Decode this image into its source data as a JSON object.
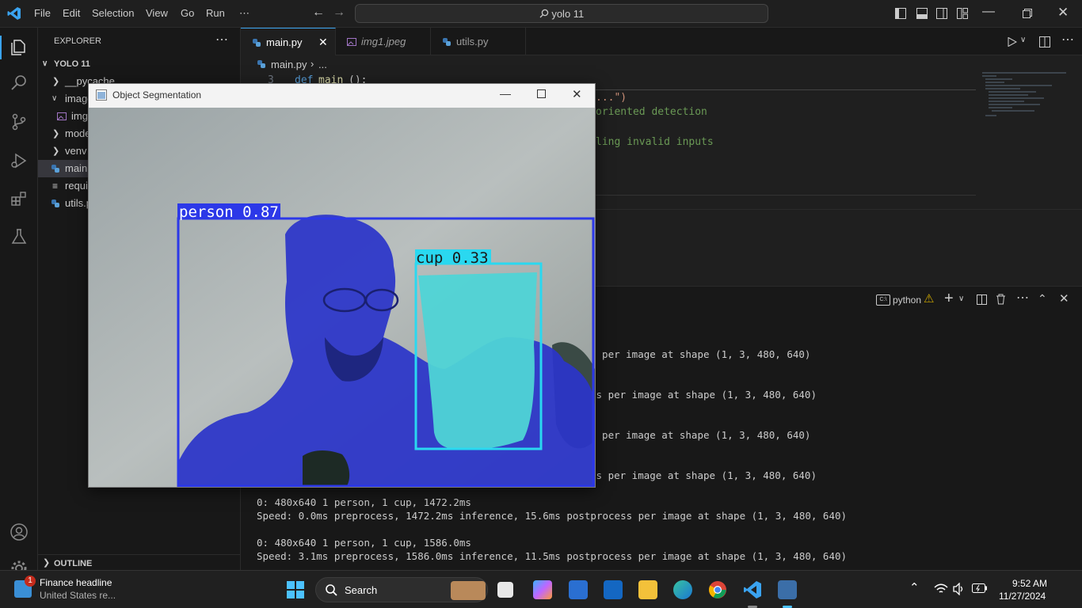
{
  "menu": [
    "File",
    "Edit",
    "Selection",
    "View",
    "Go",
    "Run",
    "⋯"
  ],
  "command_center": "yolo 11",
  "explorer": {
    "title": "EXPLORER",
    "root": "YOLO 11",
    "items": [
      {
        "label": "__pycache__",
        "kind": "folder"
      },
      {
        "label": "images",
        "kind": "folder-open"
      },
      {
        "label": "img1.jpeg",
        "kind": "image"
      },
      {
        "label": "models",
        "kind": "folder"
      },
      {
        "label": "venv",
        "kind": "folder"
      },
      {
        "label": "main.py",
        "kind": "python",
        "selected": true
      },
      {
        "label": "requirements.txt",
        "kind": "text"
      },
      {
        "label": "utils.py",
        "kind": "python"
      }
    ],
    "outline": "OUTLINE"
  },
  "tabs": [
    {
      "label": "main.py",
      "active": true
    },
    {
      "label": "img1.jpeg",
      "italic": true
    },
    {
      "label": "utils.py"
    }
  ],
  "breadcrumb": {
    "file": "main.py",
    "rest": "..."
  },
  "code": {
    "line_number": "3",
    "def_keyword": "def",
    "func_name": "main",
    "func_rest": "():",
    "frag1": "...\")",
    "frag2": "oriented detection",
    "frag3": "ling invalid inputs"
  },
  "panel": {
    "terminal_name": "python",
    "lines_partial": [
      "s per image at shape (1, 3, 480, 640)",
      "ss per image at shape (1, 3, 480, 640)",
      "s per image at shape (1, 3, 480, 640)",
      "ss per image at shape (1, 3, 480, 640)"
    ],
    "detect1": "0: 480x640 1 person, 1 cup, 1472.2ms",
    "speed1": "Speed: 0.0ms preprocess, 1472.2ms inference, 15.6ms postprocess per image at shape (1, 3, 480, 640)",
    "detect2": "0: 480x640 1 person, 1 cup, 1586.0ms",
    "speed2": "Speed: 3.1ms preprocess, 1586.0ms inference, 11.5ms postprocess per image at shape (1, 3, 480, 640)"
  },
  "seg_window": {
    "title": "Object Segmentation",
    "person_label": "person 0.87",
    "cup_label": "cup 0.33"
  },
  "taskbar": {
    "news_title": "Finance headline",
    "news_sub": "United States re...",
    "badge": "1",
    "search": "Search",
    "time": "9:52 AM",
    "date": "11/27/2024"
  },
  "colors": {
    "vscode_blue": "#3aa3f0",
    "person_box": "#2c38e8",
    "cup_box": "#2ad8f0",
    "comment_green": "#6a9955",
    "keyword_blue": "#569cd6",
    "func_yellow": "#dcdcaa",
    "string_orange": "#ce9178"
  }
}
